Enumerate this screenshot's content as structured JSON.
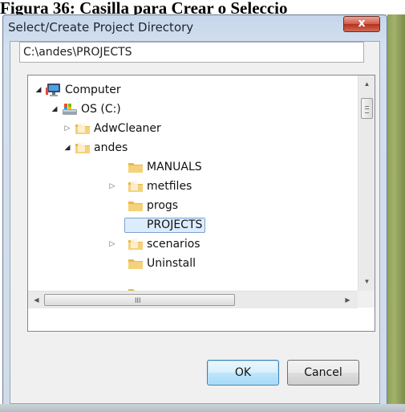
{
  "caption": "Figura 36: Casilla para Crear o Seleccio",
  "dialog": {
    "title": "Select/Create Project Directory",
    "close_glyph": "x",
    "path_value": "C:\\andes\\PROJECTS",
    "tree": {
      "items": [
        {
          "label": "Computer",
          "icon": "computer-icon",
          "expander": "expanded"
        },
        {
          "label": "OS (C:)",
          "icon": "drive-icon",
          "expander": "expanded"
        },
        {
          "label": "AdwCleaner",
          "icon": "folder-icon",
          "expander": "collapsed"
        },
        {
          "label": "andes",
          "icon": "folder-icon",
          "expander": "expanded"
        },
        {
          "label": "MANUALS",
          "icon": "folder-icon",
          "expander": "none"
        },
        {
          "label": "metfiles",
          "icon": "folder-icon",
          "expander": "collapsed"
        },
        {
          "label": "progs",
          "icon": "folder-icon",
          "expander": "none"
        },
        {
          "label": "PROJECTS",
          "icon": "folder-icon",
          "expander": "none",
          "selected": true
        },
        {
          "label": "scenarios",
          "icon": "folder-icon",
          "expander": "collapsed"
        },
        {
          "label": "Uninstall",
          "icon": "folder-icon",
          "expander": "none"
        }
      ]
    },
    "hscroll_grip": "III",
    "buttons": {
      "ok": "OK",
      "cancel": "Cancel"
    }
  }
}
